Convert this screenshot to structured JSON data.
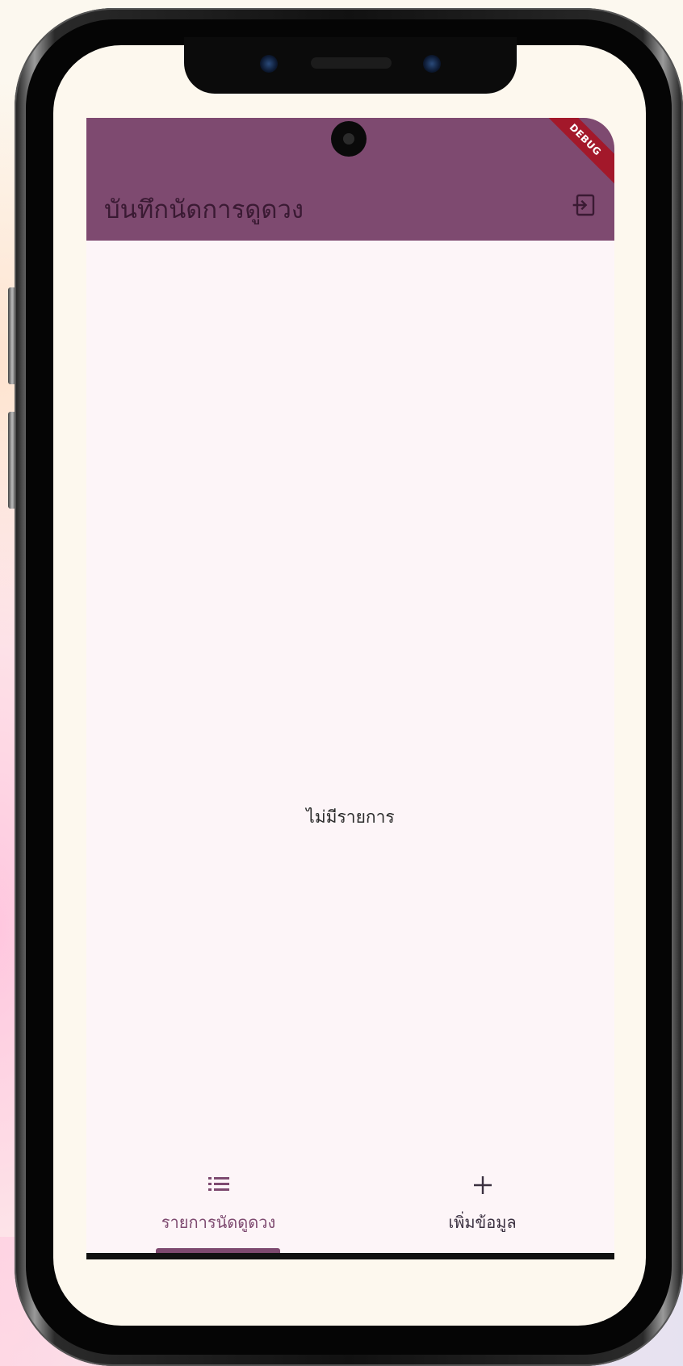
{
  "app": {
    "title": "บันทึกนัดการดูดวง",
    "debug_banner": "DEBUG",
    "empty_message": "ไม่มีรายการ",
    "accent_color": "#7e4a70"
  },
  "icons": {
    "logout": "logout-icon",
    "list": "list-icon",
    "add": "plus-icon"
  },
  "bottom_nav": {
    "items": [
      {
        "label": "รายการนัดดูดวง",
        "icon": "list-icon",
        "active": true
      },
      {
        "label": "เพิ่มข้อมูล",
        "icon": "plus-icon",
        "active": false
      }
    ]
  }
}
